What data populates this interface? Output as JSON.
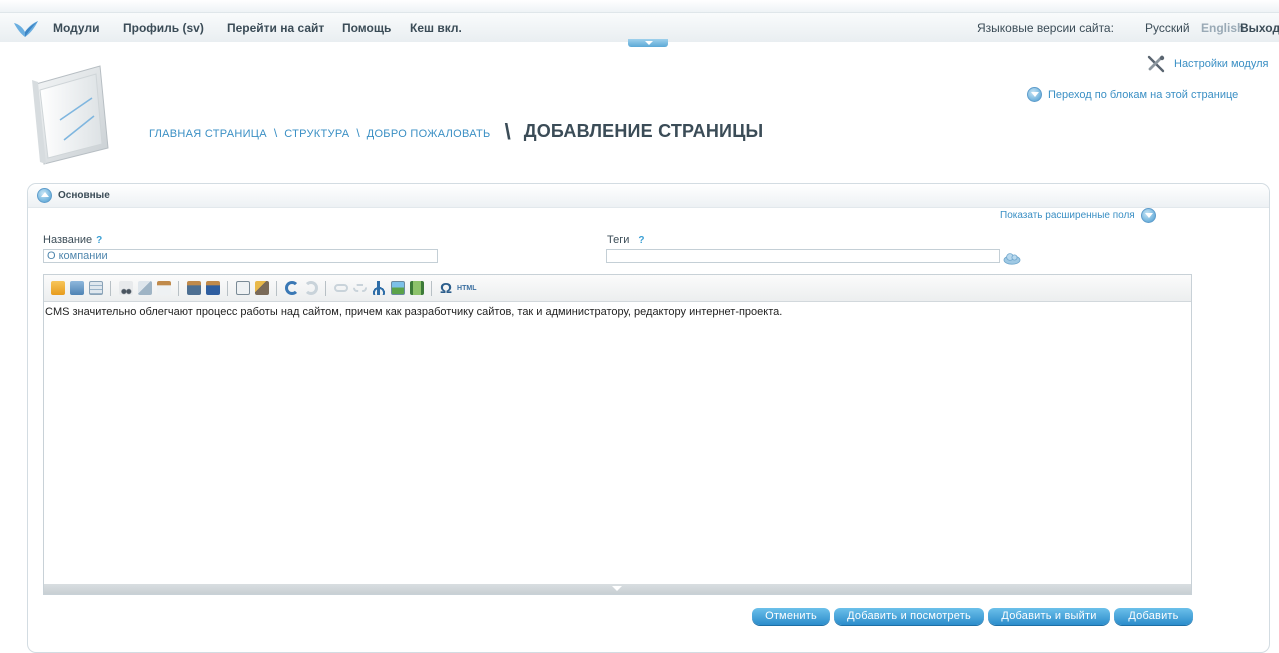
{
  "topbar": {
    "nav": [
      "Модули",
      "Профиль (sv)",
      "Перейти на сайт",
      "Помощь",
      "Кеш вкл."
    ],
    "language_label": "Языковые версии сайта:",
    "language_ru": "Русский",
    "language_en": "English",
    "exit": "Выход"
  },
  "header": {
    "breadcrumb": [
      "ГЛАВНАЯ СТРАНИЦА",
      "СТРУКТУРА",
      "ДОБРО ПОЖАЛОВАТЬ"
    ],
    "separator": "\\",
    "current": "ДОБАВЛЕНИЕ СТРАНИЦЫ",
    "module_settings": "Настройки модуля",
    "block_jump": "Переход по блокам на этой странице"
  },
  "panel": {
    "title": "Основные",
    "show_extended": "Показать расширенные поля",
    "name_label": "Название",
    "help_mark": "?",
    "name_value": "О компании",
    "tags_label": "Теги",
    "tags_value": ""
  },
  "editor": {
    "toolbar_icons": [
      "template-icon",
      "find-icon",
      "table-icon",
      "cut-icon",
      "copy-icon",
      "paste-icon",
      "paste-text-icon",
      "paste-word-icon",
      "select-all-icon",
      "clean-format-icon",
      "undo-icon",
      "redo-icon",
      "link-icon",
      "unlink-icon",
      "anchor-icon",
      "image-icon",
      "flash-icon",
      "special-char-icon",
      "html-source-icon"
    ],
    "omega": "Ω",
    "html": "HTML",
    "content": "CMS значительно облегчают процесс работы над сайтом, причем как разработчику сайтов, так и администратору, редактору интернет-проекта."
  },
  "buttons": {
    "cancel": "Отменить",
    "add_view": "Добавить и посмотреть",
    "add_exit": "Добавить и выйти",
    "add": "Добавить"
  },
  "colors": {
    "accent": "#3a8fc4",
    "heading": "#3b4c57",
    "button": "#2b8ccb"
  }
}
